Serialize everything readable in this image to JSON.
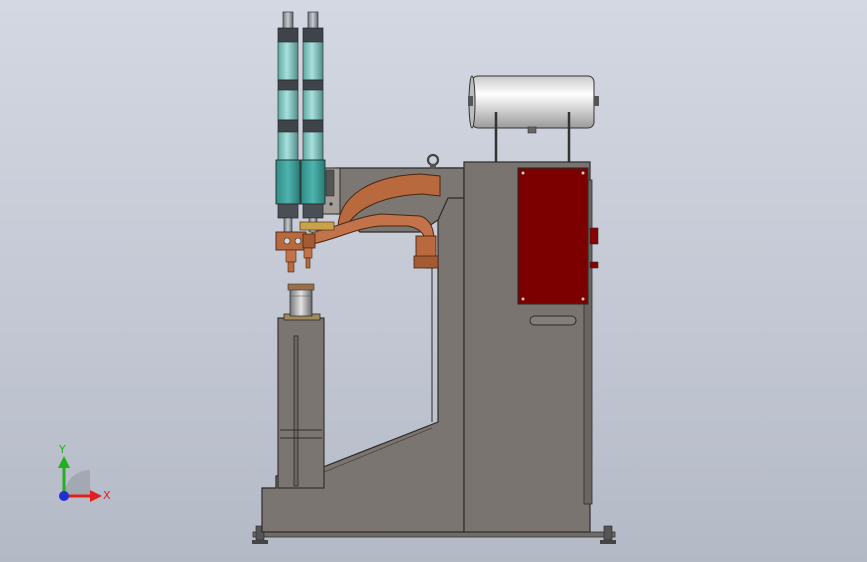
{
  "view": {
    "background_top": "#d4d8e2",
    "background_bottom": "#b4b9c6"
  },
  "triad": {
    "x_label": "X",
    "y_label": "Y",
    "x_color": "#e02020",
    "y_color": "#20b020",
    "z_color": "#2030d0"
  },
  "colors": {
    "frame": "#7a7570",
    "frame_dark": "#5e5a56",
    "cabinet": "#7a7470",
    "panel": "#7d0000",
    "cylinder": "#86c9c4",
    "copper": "#b8693d",
    "tank": "#e8e8e8"
  }
}
